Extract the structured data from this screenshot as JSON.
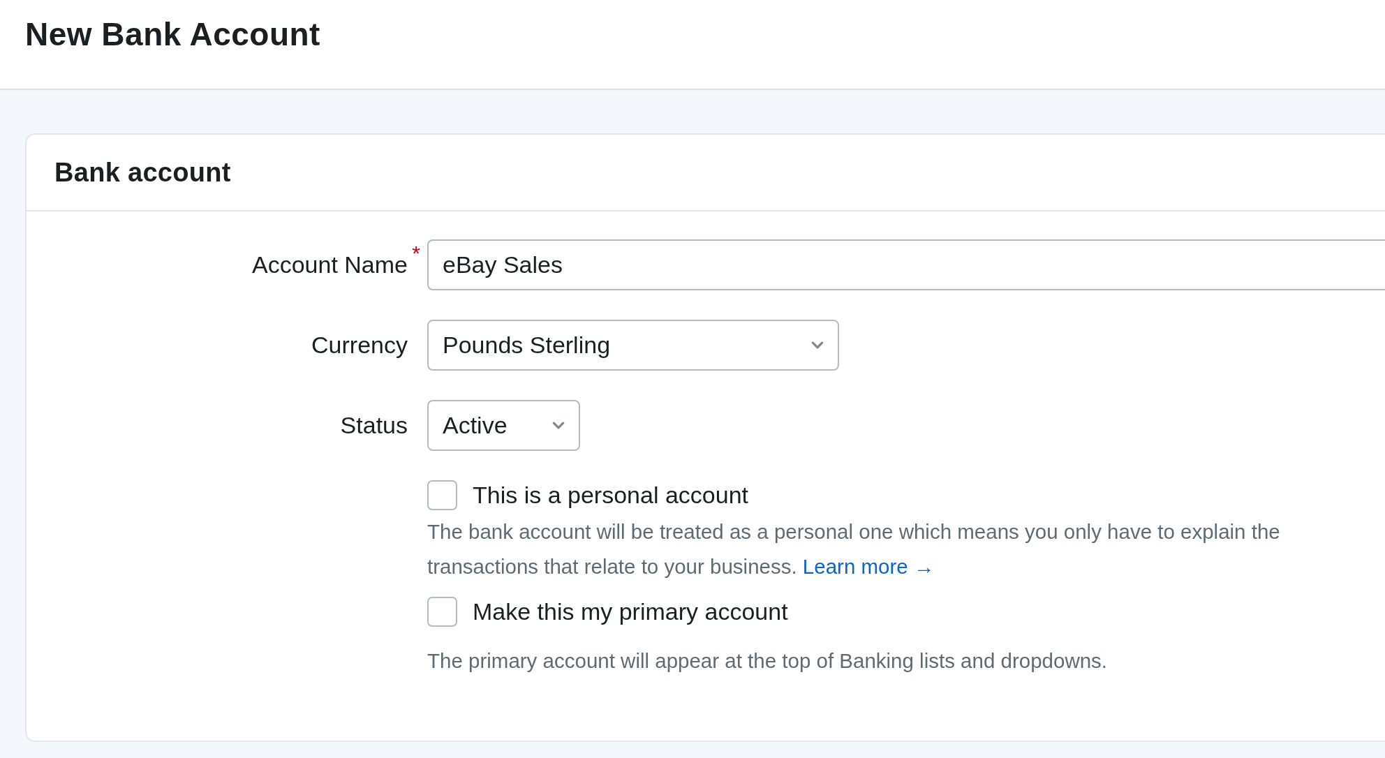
{
  "page": {
    "title": "New Bank Account"
  },
  "card": {
    "title": "Bank account",
    "fields": [
      {
        "kind": "text",
        "label": "Account Name",
        "required": true,
        "value": "eBay Sales"
      },
      {
        "kind": "select",
        "label": "Currency",
        "required": false,
        "value": "Pounds Sterling"
      },
      {
        "kind": "select-small",
        "label": "Status",
        "required": false,
        "value": "Active"
      }
    ],
    "required_mark": "*",
    "options": [
      {
        "label": "This is a personal account",
        "checked": false,
        "help": "The bank account will be treated as a personal one which means you only have to explain the transactions that relate to your business.",
        "link": "Learn more →"
      },
      {
        "label": "Make this my primary account",
        "checked": false,
        "help": "The primary account will appear at the top of Banking lists and dropdowns."
      }
    ]
  }
}
